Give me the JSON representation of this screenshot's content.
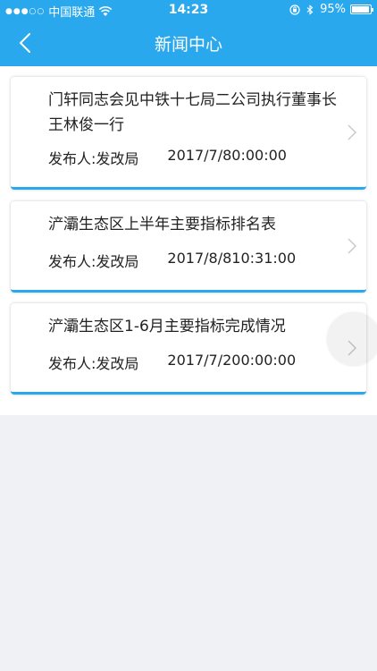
{
  "status_bar": {
    "carrier": "中国联通",
    "time": "14:23",
    "battery": "95%",
    "battery_level": 0.95
  },
  "nav": {
    "title": "新闻中心"
  },
  "news": [
    {
      "title": "门轩同志会见中铁十七局二公司执行董事长王林俊一行",
      "publisher": "发布人:发改局",
      "date": "2017/7/80:00:00"
    },
    {
      "title": "浐灞生态区上半年主要指标排名表",
      "publisher": "发布人:发改局",
      "date": "2017/8/810:31:00"
    },
    {
      "title": "浐灞生态区1-6月主要指标完成情况",
      "publisher": "发布人:发改局",
      "date": "2017/7/200:00:00"
    }
  ],
  "colors": {
    "accent": "#2aa8ee",
    "background": "#f0f1f4"
  }
}
